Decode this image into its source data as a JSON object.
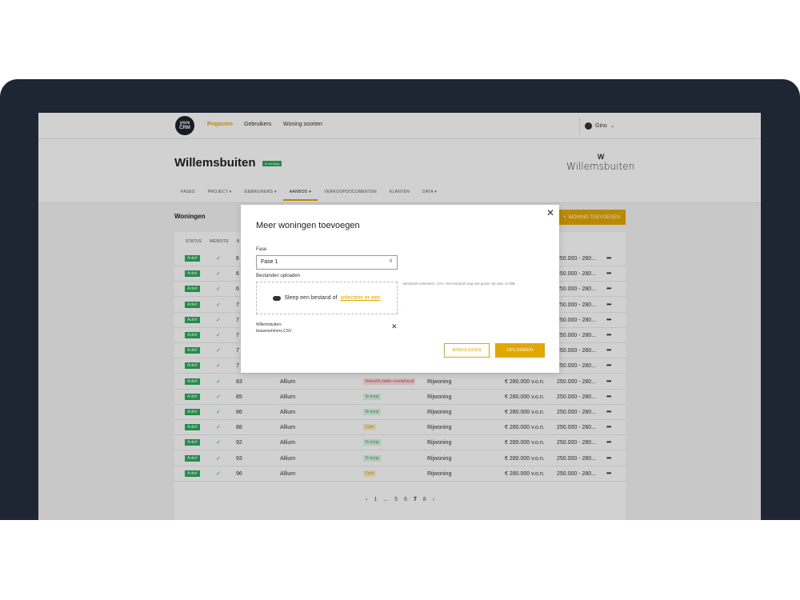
{
  "app": {
    "logo": [
      "yore",
      "CRM"
    ],
    "nav": [
      "Projecten",
      "Gebruikers",
      "Woning soorten"
    ],
    "user": "Gino"
  },
  "project": {
    "title": "Willemsbuiten",
    "status_badge": "In verkoop",
    "brand_mark": "W",
    "brand_text": "Willemsbuiten",
    "tabs": [
      "FASES",
      "PROJECT",
      "GEBRUIKERS",
      "AANBOD",
      "VERKOOPDOCUMENTEN",
      "KLANTEN",
      "DATA"
    ],
    "active_tab": "AANBOD"
  },
  "section": {
    "title": "Woningen",
    "add_button": "WONING TOEVOEGEN"
  },
  "table": {
    "headers": [
      "STATUS",
      "WEBSITE",
      "B"
    ],
    "rows": [
      {
        "status": "Actief",
        "nr": "6",
        "price_range": "250.000 - 280..."
      },
      {
        "status": "Actief",
        "nr": "6",
        "price_range": "250.000 - 280..."
      },
      {
        "status": "Actief",
        "nr": "6",
        "price_range": "250.000 - 280..."
      },
      {
        "status": "Actief",
        "nr": "7",
        "price_range": "250.000 - 280..."
      },
      {
        "status": "Actief",
        "nr": "7",
        "price_range": "250.000 - 280..."
      },
      {
        "status": "Actief",
        "nr": "7",
        "price_range": "250.000 - 280..."
      },
      {
        "status": "Actief",
        "nr": "7",
        "price_range": "250.000 - 280..."
      },
      {
        "status": "Actief",
        "nr": "7",
        "price_range": "250.000 - 280..."
      },
      {
        "status": "Actief",
        "nr": "83",
        "type": "Allium",
        "badge": "Verkocht onder voorbehoud",
        "badge_color": "#d64545",
        "badge_bg": "#fbe3e3",
        "woning": "Rijwoning",
        "price": "€ 280.000 v.o.n.",
        "price_range": "250.000 - 280..."
      },
      {
        "status": "Actief",
        "nr": "85",
        "type": "Allium",
        "badge": "Te koop",
        "badge_color": "#2eaa5a",
        "badge_bg": "#e2f5e9",
        "woning": "Rijwoning",
        "price": "€ 280.000 v.o.n.",
        "price_range": "250.000 - 280..."
      },
      {
        "status": "Actief",
        "nr": "86",
        "type": "Allium",
        "badge": "Te koop",
        "badge_color": "#2eaa5a",
        "badge_bg": "#e2f5e9",
        "woning": "Rijwoning",
        "price": "€ 280.000 v.o.n.",
        "price_range": "250.000 - 280..."
      },
      {
        "status": "Actief",
        "nr": "88",
        "type": "Allium",
        "badge": "Optie",
        "badge_color": "#e3a800",
        "badge_bg": "#fdf1d0",
        "woning": "Rijwoning",
        "price": "€ 280.000 v.o.n.",
        "price_range": "250.000 - 280..."
      },
      {
        "status": "Actief",
        "nr": "92",
        "type": "Allium",
        "badge": "Te koop",
        "badge_color": "#2eaa5a",
        "badge_bg": "#e2f5e9",
        "woning": "Rijwoning",
        "price": "€ 280.000 v.o.n.",
        "price_range": "250.000 - 280..."
      },
      {
        "status": "Actief",
        "nr": "93",
        "type": "Allium",
        "badge": "Te koop",
        "badge_color": "#2eaa5a",
        "badge_bg": "#e2f5e9",
        "woning": "Rijwoning",
        "price": "€ 280.000 v.o.n.",
        "price_range": "250.000 - 280..."
      },
      {
        "status": "Actief",
        "nr": "96",
        "type": "Allium",
        "badge": "Optie",
        "badge_color": "#e3a800",
        "badge_bg": "#fdf1d0",
        "woning": "Rijwoning",
        "price": "€ 280.000 v.o.n.",
        "price_range": "250.000 - 280..."
      }
    ]
  },
  "pagination": [
    "1",
    "...",
    "5",
    "6",
    "7",
    "8"
  ],
  "pagination_current": "7",
  "modal": {
    "title": "Meer woningen toevoegen",
    "fase_label": "Fase",
    "fase_value": "Fase 1",
    "upload_label": "Bestanden uploaden",
    "dropzone_text": "Sleep een bestand of",
    "dropzone_link": "selecteer er een",
    "hint": "Bestands extensies: CSV. Het bestand mag niet groter zijn dan 10 MB.",
    "file_name": "Willemsbuiten-bouwnummers.CSV",
    "cancel": "ANNULEREN",
    "upload": "UPLOADEN"
  },
  "colors": {
    "accent": "#e3a800",
    "success": "#2eaa5a",
    "frame": "#1e2533"
  }
}
